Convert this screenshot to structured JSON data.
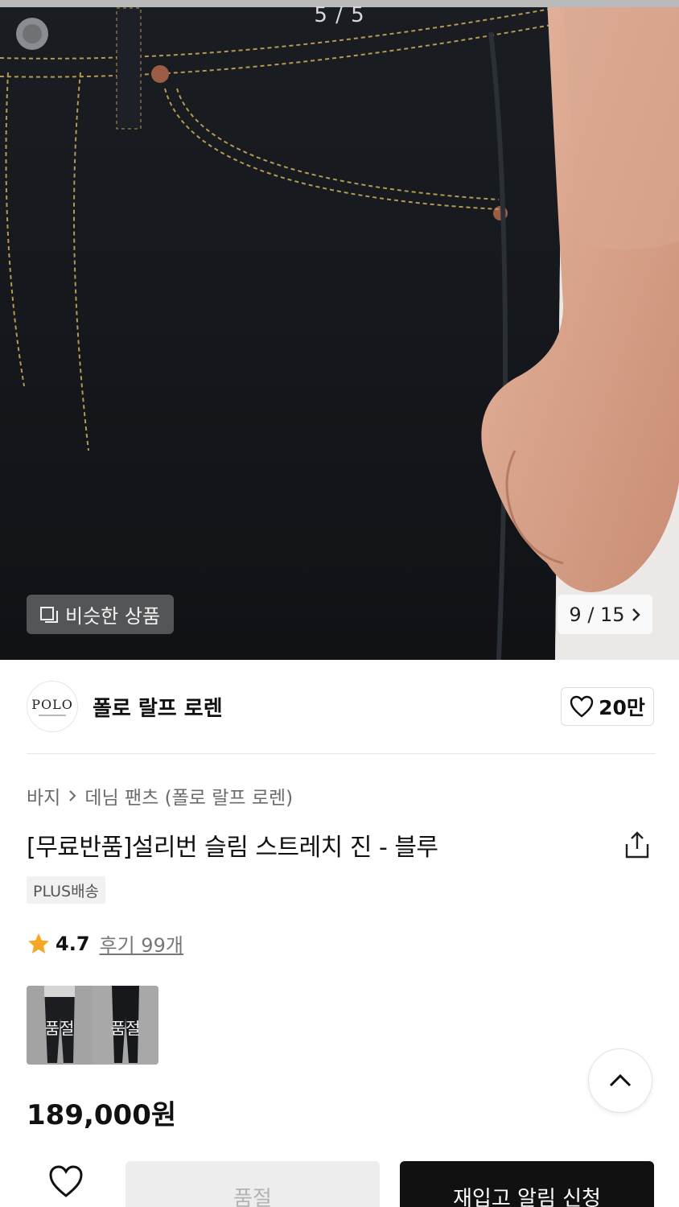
{
  "hero": {
    "image_counter": "5 / 5",
    "similar_button_label": "비슷한 상품",
    "pager_label": "9 / 15"
  },
  "brand": {
    "logo_text": "POLO",
    "name": "폴로 랄프 로렌",
    "likes_label": "20만"
  },
  "breadcrumb": {
    "category": "바지",
    "subcategory": "데님 팬츠 (폴로 랄프 로렌)"
  },
  "product": {
    "title": "[무료반품]설리번 슬림 스트레치 진 - 블루",
    "shipping_badge": "PLUS배송",
    "rating": "4.7",
    "reviews_label": "후기 99개",
    "price": "189,000원",
    "variants": [
      {
        "status": "품절"
      },
      {
        "status": "품절"
      }
    ]
  },
  "bottom_bar": {
    "soldout_label": "품절",
    "restock_label": "재입고 알림 신청"
  },
  "colors": {
    "accent_star": "#f5a623",
    "primary_button": "#111111",
    "disabled_button": "#ededed"
  }
}
